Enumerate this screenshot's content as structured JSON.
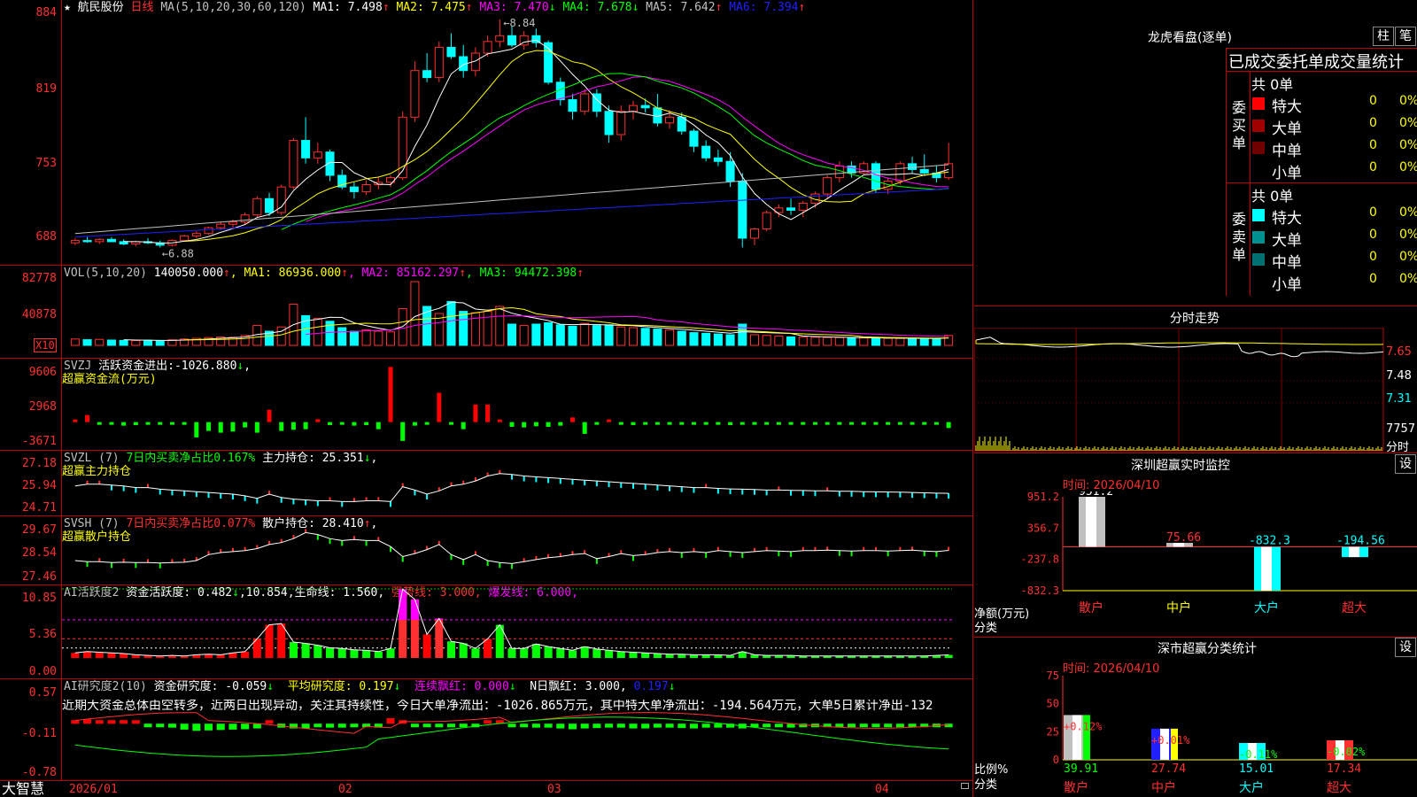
{
  "stock": {
    "name": "航民股份",
    "period": "日线",
    "star_icon": "★"
  },
  "price": {
    "y_ticks": [
      "884",
      "819",
      "753",
      "688"
    ],
    "ma_title": "MA(5,10,20,30,60,120)",
    "ma": [
      {
        "label": "MA1:",
        "value": "7.498",
        "arrow": "↑",
        "color": "#ffffff"
      },
      {
        "label": "MA2:",
        "value": "7.475",
        "arrow": "↑",
        "color": "#ffff00"
      },
      {
        "label": "MA3:",
        "value": "7.470",
        "arrow": "↓",
        "color": "#ff00ff"
      },
      {
        "label": "MA4:",
        "value": "7.678",
        "arrow": "↓",
        "color": "#00ff00"
      },
      {
        "label": "MA5:",
        "value": "7.642",
        "arrow": "↑",
        "color": "#c0c0c0"
      },
      {
        "label": "MA6:",
        "value": "7.394",
        "arrow": "↑",
        "color": "#2020ff"
      }
    ],
    "high_label": "8.84",
    "low_label": "6.88"
  },
  "vol": {
    "title": "VOL(5,10,20)",
    "value": "140050.000",
    "arrow": "↑",
    "ma": [
      {
        "label": "MA1:",
        "value": "86936.000",
        "arrow": "↑",
        "color": "#ffff00"
      },
      {
        "label": "MA2:",
        "value": "85162.297",
        "arrow": "↑",
        "color": "#ff00ff"
      },
      {
        "label": "MA3:",
        "value": "94472.398",
        "arrow": "↑",
        "color": "#00ff00"
      }
    ],
    "y_ticks": [
      "82778",
      "40878"
    ],
    "unit": "X10"
  },
  "svzj": {
    "title": "SVZJ",
    "text": "活跃资金进出:",
    "value": "-1026.880",
    "arrow": "↓",
    "tail": ",",
    "sub": "超赢资金流(万元)",
    "y_ticks": [
      "9606",
      "2968",
      "-3671"
    ]
  },
  "svzl": {
    "title": "SVZL (7)",
    "text": "7日内买卖净占比0.167%",
    "text2": "主力持仓:",
    "value": "25.351",
    "arrow": "↓",
    "tail": ",",
    "sub": "超赢主力持仓",
    "y_ticks": [
      "27.18",
      "25.94",
      "24.71"
    ]
  },
  "svsh": {
    "title": "SVSH (7)",
    "text": "7日内买卖净占比0.077%",
    "text2": "散户持仓:",
    "value": "28.410",
    "arrow": "↑",
    "tail": ",",
    "sub": "超赢散户持仓",
    "y_ticks": [
      "29.67",
      "28.54",
      "27.46"
    ]
  },
  "ai1": {
    "title": "AI活跃度2",
    "text": "资金活跃度:",
    "v1": "0.482",
    "a1": "↓",
    "v2": ",10.854,",
    "text2": "生命线:",
    "v3": "1.560,",
    "strong": "强势线: 3.000,",
    "burst": "爆发线: 6.000,",
    "y_ticks": [
      "10.85",
      "5.36",
      "0.00"
    ]
  },
  "ai2": {
    "title": "AI研究度2(10)",
    "text": "资金研究度:",
    "v1": "-0.059",
    "a1": "↓",
    "avg": "平均研究度: 0.197",
    "a2": "↓",
    "red": "连续飘红: 0.000",
    "a3": "↓",
    "n": "N日飘红: 3.000,",
    "v4": "0.197",
    "a4": "↓",
    "y_ticks": [
      "0.57",
      "-0.11",
      "-0.78"
    ],
    "comment": "近期大资金总体由空转多，近两日出现异动，关注其持续性，今日大单净流出：-1026.865万元，其中特大单净流出：-194.564万元，大单5日累计净出-132"
  },
  "x_axis": {
    "labels": [
      "2026/01",
      "02",
      "03",
      "04"
    ]
  },
  "brand": "大智慧",
  "right": {
    "lhb": {
      "title": "龙虎看盘(逐单)",
      "btn1": "柱",
      "btn2": "笔",
      "tabs": "已成交委托单成交量统计",
      "buy": {
        "side": "委买单",
        "total": "共 0单",
        "rows": [
          {
            "name": "特大",
            "v": "0",
            "p": "0%",
            "color": "#ff0000"
          },
          {
            "name": "大单",
            "v": "0",
            "p": "0%",
            "color": "#a00000"
          },
          {
            "name": "中单",
            "v": "0",
            "p": "0%",
            "color": "#700000"
          },
          {
            "name": "小单",
            "v": "0",
            "p": "0%",
            "color": "#000000"
          }
        ]
      },
      "sell": {
        "side": "委卖单",
        "total": "共 0单",
        "rows": [
          {
            "name": "特大",
            "v": "0",
            "p": "0%",
            "color": "#00ffff"
          },
          {
            "name": "大单",
            "v": "0",
            "p": "0%",
            "color": "#009090"
          },
          {
            "name": "中单",
            "v": "0",
            "p": "0%",
            "color": "#007070"
          },
          {
            "name": "小单",
            "v": "0",
            "p": "0%",
            "color": "#000000"
          }
        ]
      }
    },
    "fs": {
      "title": "分时走势",
      "y_ticks": [
        "7.65",
        "7.48",
        "7.31"
      ],
      "vol": "7757",
      "vol_unit": "分时"
    },
    "monitor": {
      "title": "深圳超赢实时监控",
      "set": "设",
      "time": "时间: 2026/04/10",
      "y_ticks": [
        "951.2",
        "356.7",
        "-237.8",
        "-832.3"
      ],
      "y_title": "净额(万元)",
      "x_title": "分类",
      "bars": [
        {
          "cat": "散户",
          "value": 951.2,
          "label": "951.2"
        },
        {
          "cat": "中户",
          "value": 75.66,
          "label": "75.66"
        },
        {
          "cat": "大户",
          "value": -832.3,
          "label": "-832.3"
        },
        {
          "cat": "超大",
          "value": -194.56,
          "label": "-194.56"
        }
      ]
    },
    "cls": {
      "title": "深市超赢分类统计",
      "set": "设",
      "time": "时间: 2026/04/10",
      "y_ticks": [
        "75",
        "50",
        "25",
        "0"
      ],
      "y_title": "比例%",
      "x_title": "分类",
      "bars": [
        {
          "cat": "散户",
          "value": 39.91,
          "label": "39.91",
          "pct": "+0.12%"
        },
        {
          "cat": "中户",
          "value": 27.74,
          "label": "27.74",
          "pct": "+0.01%"
        },
        {
          "cat": "大户",
          "value": 15.01,
          "label": "15.01",
          "pct": "-0.11%"
        },
        {
          "cat": "超大",
          "value": 17.34,
          "label": "17.34",
          "pct": "-0.02%"
        }
      ]
    }
  },
  "chart_data": [
    {
      "type": "candlestick",
      "title": "",
      "ylim": [
        6.8,
        8.9
      ],
      "ohlc": [
        [
          6.92,
          6.96,
          6.9,
          6.94
        ],
        [
          6.94,
          6.97,
          6.92,
          6.93
        ],
        [
          6.93,
          6.96,
          6.91,
          6.95
        ],
        [
          6.95,
          6.97,
          6.93,
          6.93
        ],
        [
          6.93,
          6.95,
          6.9,
          6.91
        ],
        [
          6.91,
          6.94,
          6.89,
          6.93
        ],
        [
          6.93,
          6.96,
          6.91,
          6.92
        ],
        [
          6.92,
          6.94,
          6.88,
          6.9
        ],
        [
          6.9,
          6.95,
          6.89,
          6.94
        ],
        [
          6.94,
          6.99,
          6.93,
          6.98
        ],
        [
          6.98,
          7.02,
          6.96,
          7.0
        ],
        [
          7.0,
          7.06,
          6.99,
          7.05
        ],
        [
          7.05,
          7.1,
          7.03,
          7.08
        ],
        [
          7.08,
          7.12,
          7.05,
          7.1
        ],
        [
          7.1,
          7.18,
          7.08,
          7.16
        ],
        [
          7.16,
          7.32,
          7.14,
          7.3
        ],
        [
          7.3,
          7.35,
          7.15,
          7.18
        ],
        [
          7.18,
          7.42,
          7.16,
          7.4
        ],
        [
          7.4,
          7.82,
          7.38,
          7.8
        ],
        [
          7.8,
          8.0,
          7.6,
          7.65
        ],
        [
          7.65,
          7.78,
          7.6,
          7.7
        ],
        [
          7.7,
          7.72,
          7.45,
          7.5
        ],
        [
          7.5,
          7.55,
          7.38,
          7.4
        ],
        [
          7.4,
          7.44,
          7.3,
          7.36
        ],
        [
          7.36,
          7.46,
          7.33,
          7.42
        ],
        [
          7.42,
          7.48,
          7.38,
          7.44
        ],
        [
          7.44,
          7.5,
          7.4,
          7.48
        ],
        [
          7.48,
          8.05,
          7.46,
          8.0
        ],
        [
          8.0,
          8.48,
          7.96,
          8.4
        ],
        [
          8.4,
          8.55,
          8.3,
          8.34
        ],
        [
          8.34,
          8.65,
          8.3,
          8.6
        ],
        [
          8.6,
          8.72,
          8.5,
          8.52
        ],
        [
          8.52,
          8.62,
          8.34,
          8.4
        ],
        [
          8.4,
          8.6,
          8.35,
          8.55
        ],
        [
          8.55,
          8.7,
          8.52,
          8.65
        ],
        [
          8.65,
          8.84,
          8.6,
          8.7
        ],
        [
          8.7,
          8.78,
          8.6,
          8.62
        ],
        [
          8.62,
          8.74,
          8.58,
          8.7
        ],
        [
          8.7,
          8.76,
          8.6,
          8.64
        ],
        [
          8.64,
          8.66,
          8.28,
          8.3
        ],
        [
          8.3,
          8.34,
          8.1,
          8.15
        ],
        [
          8.15,
          8.2,
          7.98,
          8.05
        ],
        [
          8.05,
          8.24,
          8.02,
          8.2
        ],
        [
          8.2,
          8.24,
          8.0,
          8.05
        ],
        [
          8.05,
          8.1,
          7.78,
          7.85
        ],
        [
          7.85,
          8.1,
          7.8,
          8.05
        ],
        [
          8.05,
          8.14,
          7.98,
          8.1
        ],
        [
          8.1,
          8.16,
          8.04,
          8.08
        ],
        [
          8.08,
          8.2,
          7.92,
          7.95
        ],
        [
          7.95,
          8.06,
          7.9,
          8.0
        ],
        [
          8.0,
          8.04,
          7.85,
          7.88
        ],
        [
          7.88,
          7.9,
          7.7,
          7.75
        ],
        [
          7.75,
          7.8,
          7.62,
          7.65
        ],
        [
          7.65,
          7.72,
          7.58,
          7.62
        ],
        [
          7.62,
          7.7,
          7.4,
          7.45
        ],
        [
          7.45,
          7.52,
          6.88,
          6.96
        ],
        [
          6.96,
          7.05,
          6.9,
          7.04
        ],
        [
          7.04,
          7.2,
          7.02,
          7.18
        ],
        [
          7.18,
          7.25,
          7.14,
          7.22
        ],
        [
          7.22,
          7.3,
          7.16,
          7.2
        ],
        [
          7.2,
          7.28,
          7.14,
          7.26
        ],
        [
          7.26,
          7.36,
          7.22,
          7.34
        ],
        [
          7.34,
          7.5,
          7.3,
          7.48
        ],
        [
          7.48,
          7.62,
          7.44,
          7.58
        ],
        [
          7.58,
          7.62,
          7.48,
          7.52
        ],
        [
          7.52,
          7.62,
          7.5,
          7.6
        ],
        [
          7.6,
          7.62,
          7.35,
          7.38
        ],
        [
          7.38,
          7.48,
          7.34,
          7.45
        ],
        [
          7.45,
          7.62,
          7.42,
          7.6
        ],
        [
          7.6,
          7.66,
          7.52,
          7.55
        ],
        [
          7.55,
          7.68,
          7.5,
          7.52
        ],
        [
          7.52,
          7.58,
          7.44,
          7.48
        ],
        [
          7.48,
          7.78,
          7.46,
          7.6
        ]
      ]
    },
    {
      "type": "bar",
      "name": "VOL",
      "ylim": [
        0,
        100000
      ],
      "values": [
        9000,
        8000,
        8500,
        7500,
        7000,
        6800,
        7200,
        6500,
        7800,
        9000,
        10000,
        11000,
        12000,
        11500,
        14000,
        28000,
        20000,
        26000,
        58000,
        42000,
        38000,
        34000,
        25000,
        20000,
        22000,
        20000,
        19000,
        52000,
        90000,
        55000,
        45000,
        62000,
        48000,
        46000,
        48000,
        55000,
        30000,
        28000,
        30000,
        32000,
        29000,
        27000,
        31000,
        28000,
        29000,
        26000,
        25000,
        24000,
        23000,
        22000,
        20000,
        18000,
        17000,
        16000,
        15000,
        30000,
        15000,
        14000,
        13000,
        12000,
        12000,
        11500,
        11000,
        11000,
        10500,
        10500,
        10000,
        10000,
        9800,
        9500,
        9800,
        9500,
        14000
      ]
    },
    {
      "type": "bar",
      "name": "SVZJ",
      "ylim": [
        -3671,
        9606
      ],
      "values": [
        200,
        1200,
        -300,
        -400,
        -600,
        -500,
        -300,
        -200,
        -300,
        -100,
        -2600,
        -1500,
        -1800,
        -1600,
        -900,
        -1800,
        2100,
        -1500,
        -1300,
        -1200,
        500,
        -500,
        -400,
        -600,
        -500,
        -1200,
        9400,
        -3200,
        -600,
        -400,
        5000,
        -200,
        -1200,
        3000,
        3000,
        100,
        -800,
        -900,
        -700,
        -800,
        -600,
        800,
        -2000,
        -300,
        400,
        -400,
        -500,
        -300,
        -400,
        -200,
        -300,
        -200,
        -300,
        -400,
        -500,
        -300,
        -200,
        -100,
        -300,
        -200,
        -100,
        -100,
        -200,
        -150,
        -250,
        -100,
        -200,
        -100,
        -150,
        -300,
        -200,
        -100,
        -1000
      ]
    },
    {
      "type": "line",
      "name": "SVZL",
      "ylim": [
        24.71,
        27.18
      ],
      "values": [
        25.8,
        25.9,
        25.9,
        25.85,
        25.8,
        25.7,
        25.7,
        25.6,
        25.55,
        25.5,
        25.45,
        25.4,
        25.35,
        25.3,
        25.2,
        25.05,
        25.3,
        25.1,
        25.0,
        24.95,
        24.9,
        24.9,
        24.85,
        24.85,
        24.9,
        24.9,
        24.85,
        25.75,
        25.55,
        25.3,
        25.5,
        25.8,
        25.9,
        26.1,
        26.4,
        26.55,
        26.5,
        26.4,
        26.35,
        26.3,
        26.25,
        26.2,
        26.15,
        26.1,
        26.05,
        26.0,
        25.95,
        25.9,
        25.85,
        25.8,
        25.75,
        25.7,
        25.7,
        25.65,
        25.62,
        25.6,
        25.58,
        25.55,
        25.55,
        25.53,
        25.52,
        25.5,
        25.5,
        25.48,
        25.47,
        25.45,
        25.44,
        25.43,
        25.42,
        25.4,
        25.38,
        25.36,
        25.35
      ]
    },
    {
      "type": "line",
      "name": "SVSH",
      "ylim": [
        27.46,
        29.67
      ],
      "values": [
        27.9,
        27.85,
        27.85,
        27.8,
        27.82,
        27.8,
        27.8,
        27.78,
        27.8,
        27.82,
        27.9,
        28.2,
        28.3,
        28.35,
        28.4,
        28.5,
        28.7,
        28.8,
        29.0,
        29.3,
        29.2,
        29.0,
        28.9,
        28.95,
        28.9,
        28.9,
        28.6,
        28.1,
        28.25,
        28.45,
        28.7,
        28.2,
        27.95,
        28.2,
        27.9,
        27.8,
        27.75,
        27.85,
        27.95,
        28.05,
        28.1,
        28.2,
        28.25,
        28.0,
        28.1,
        28.25,
        28.15,
        28.2,
        28.3,
        28.35,
        28.3,
        28.35,
        28.3,
        28.4,
        28.35,
        28.3,
        28.35,
        28.4,
        28.38,
        28.35,
        28.4,
        28.4,
        28.42,
        28.4,
        28.38,
        28.4,
        28.4,
        28.38,
        28.4,
        28.42,
        28.38,
        28.35,
        28.41
      ]
    },
    {
      "type": "bar",
      "name": "AI活跃度2",
      "ylim": [
        0,
        10.85
      ],
      "values": [
        0.8,
        1.0,
        0.9,
        0.8,
        0.7,
        0.5,
        0.4,
        0.3,
        0.4,
        0.3,
        0.5,
        0.6,
        0.5,
        0.8,
        1.0,
        3.0,
        5.2,
        5.4,
        2.5,
        2.3,
        2.0,
        1.6,
        1.5,
        1.3,
        1.2,
        1.0,
        1.5,
        10.8,
        9.2,
        3.7,
        6.2,
        2.6,
        2.3,
        1.5,
        3.0,
        5.2,
        1.5,
        1.5,
        2.2,
        1.8,
        1.5,
        1.2,
        1.8,
        1.4,
        1.2,
        1.0,
        0.9,
        0.8,
        0.7,
        0.6,
        0.6,
        0.5,
        0.5,
        0.5,
        0.4,
        1.0,
        0.5,
        0.4,
        0.4,
        0.4,
        0.3,
        0.3,
        0.3,
        0.3,
        0.3,
        0.3,
        0.3,
        0.3,
        0.3,
        0.3,
        0.3,
        0.4,
        0.48
      ]
    },
    {
      "type": "bar",
      "name": "AI研究度2(10)",
      "ylim": [
        -0.78,
        0.57
      ],
      "values": [
        0.05,
        0.12,
        0.06,
        0.08,
        0.06,
        0.02,
        -0.05,
        -0.07,
        -0.1,
        -0.15,
        -0.18,
        -0.17,
        -0.16,
        -0.15,
        -0.14,
        -0.12,
        0.08,
        -0.1,
        -0.12,
        -0.12,
        -0.08,
        -0.1,
        -0.1,
        -0.08,
        -0.09,
        -0.1,
        0.14,
        0.05,
        -0.03,
        -0.05,
        -0.03,
        -0.08,
        -0.06,
        -0.08,
        0.02,
        0.03,
        -0.08,
        -0.08,
        -0.1,
        -0.1,
        -0.12,
        -0.14,
        -0.12,
        -0.11,
        -0.1,
        -0.1,
        -0.12,
        -0.12,
        -0.1,
        -0.1,
        -0.11,
        -0.12,
        -0.1,
        -0.1,
        -0.1,
        -0.12,
        -0.06,
        -0.08,
        -0.08,
        -0.1,
        -0.09,
        -0.08,
        -0.06,
        -0.07,
        -0.08,
        -0.06,
        -0.05,
        -0.04,
        -0.05,
        -0.04,
        -0.05,
        -0.06,
        -0.059
      ]
    }
  ]
}
